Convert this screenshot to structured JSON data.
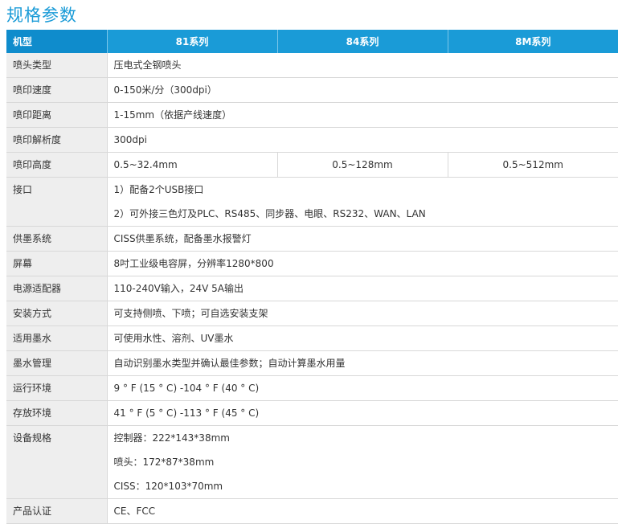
{
  "title": "规格参数",
  "headers": [
    "机型",
    "81系列",
    "84系列",
    "8M系列"
  ],
  "rows": {
    "nozzle_type": {
      "label": "喷头类型",
      "value": "压电式全钢喷头"
    },
    "print_speed": {
      "label": "喷印速度",
      "value": "0-150米/分（300dpi）"
    },
    "print_distance": {
      "label": "喷印距离",
      "value": "1-15mm（依据产线速度）"
    },
    "resolution": {
      "label": "喷印解析度",
      "value": "300dpi"
    },
    "print_height": {
      "label": "喷印高度",
      "values": [
        "0.5~32.4mm",
        "0.5~128mm",
        "0.5~512mm"
      ]
    },
    "interface": {
      "label": "接口",
      "lines": [
        "1）配备2个USB接口",
        "2）可外接三色灯及PLC、RS485、同步器、电眼、RS232、WAN、LAN"
      ]
    },
    "ink_supply": {
      "label": "供墨系统",
      "value": "CISS供墨系统，配备墨水报警灯"
    },
    "screen": {
      "label": "屏幕",
      "value": "8吋工业级电容屏，分辨率1280*800"
    },
    "power": {
      "label": "电源适配器",
      "value": "110-240V输入，24V 5A输出"
    },
    "install": {
      "label": "安装方式",
      "value": "可支持侧喷、下喷；可自选安装支架"
    },
    "ink": {
      "label": "适用墨水",
      "value": "可使用水性、溶剂、UV墨水"
    },
    "ink_mgmt": {
      "label": "墨水管理",
      "value": "自动识别墨水类型并确认最佳参数；自动计算墨水用量"
    },
    "op_env": {
      "label": "运行环境",
      "value": "9 ° F (15 ° C) -104 ° F (40 ° C)"
    },
    "storage_env": {
      "label": "存放环境",
      "value": "41 °  F (5 ° C) -113 ° F (45 ° C)"
    },
    "dimensions": {
      "label": "设备规格",
      "lines": [
        "控制器：222*143*38mm",
        "喷头：172*87*38mm",
        "CISS：120*103*70mm"
      ]
    },
    "cert": {
      "label": "产品认证",
      "value": "CE、FCC"
    }
  }
}
